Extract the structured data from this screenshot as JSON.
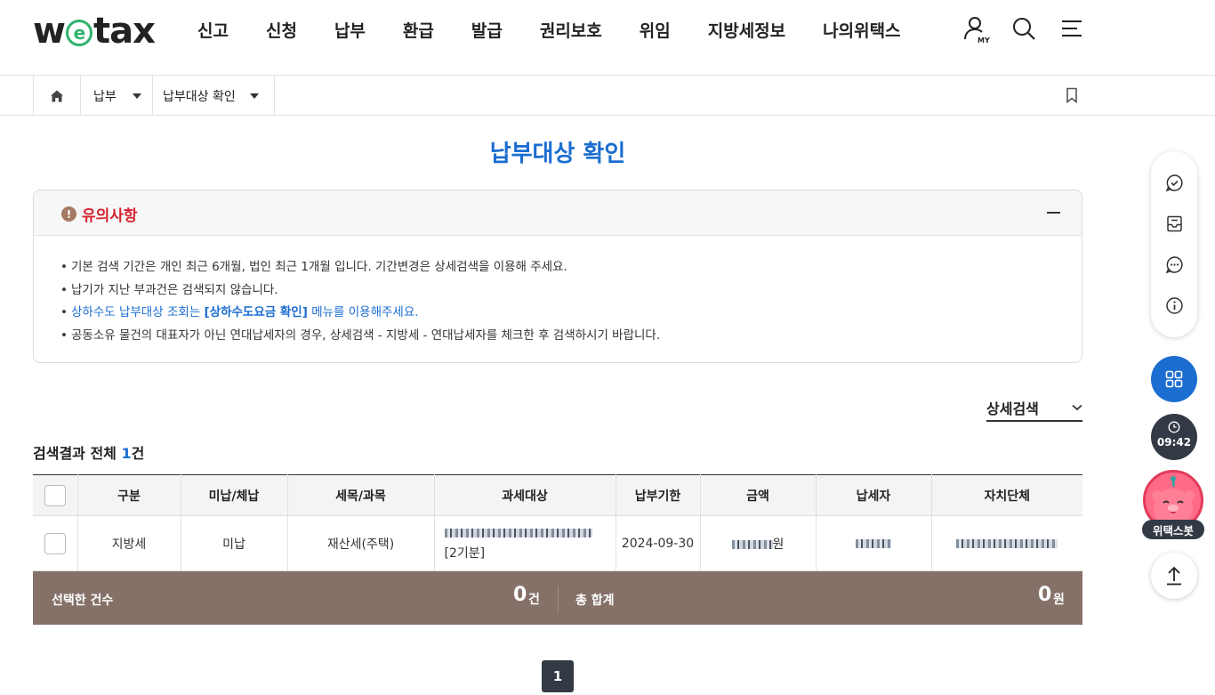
{
  "header": {
    "logo": {
      "pre": "w",
      "circle": "e",
      "post": "tax"
    },
    "menu": [
      "신고",
      "신청",
      "납부",
      "환급",
      "발급",
      "권리보호",
      "위임",
      "지방세정보",
      "나의위택스"
    ],
    "my_label": "MY"
  },
  "breadcrumb": {
    "level1": "납부",
    "level2": "납부대상 확인"
  },
  "page": {
    "title": "납부대상 확인"
  },
  "notice": {
    "title": "유의사항",
    "items": [
      "기본 검색 기간은 개인 최근 6개월, 법인 최근 1개월 입니다. 기간변경은 상세검색을 이용해 주세요.",
      "납기가 지난 부과건은 검색되지 않습니다."
    ],
    "link_item": {
      "pre": "상하수도 납부대상 조회는 ",
      "strong": "[상하수도요금 확인]",
      "post": " 메뉴를 이용해주세요."
    },
    "last_item": "공동소유 물건의 대표자가 아닌 연대납세자의 경우, 상세검색 - 지방세 - 연대납세자를 체크한 후 검색하시기 바랍니다."
  },
  "detail_search": {
    "label": "상세검색"
  },
  "result": {
    "label": "검색결과 전체 ",
    "count": "1",
    "unit": "건"
  },
  "table": {
    "headers": [
      "구분",
      "미납/체납",
      "세목/과목",
      "과세대상",
      "납부기한",
      "금액",
      "납세자",
      "자치단체"
    ],
    "rows": [
      {
        "category": "지방세",
        "status": "미납",
        "tax_item": "재산세(주택)",
        "period": "[2기분]",
        "due_date": "2024-09-30",
        "amount_unit": "원"
      }
    ]
  },
  "summary": {
    "count_label": "선택한 건수",
    "count_value": "0",
    "count_unit": "건",
    "total_label": "총 합계",
    "total_value": "0",
    "total_unit": "원"
  },
  "pagination": {
    "current": "1"
  },
  "quick_menu": {
    "timer": "09:42",
    "bot_label": "위택스봇"
  },
  "colors": {
    "accent_blue": "#1b6dd0",
    "notice_red": "#d6222e",
    "summary_bg": "#857168",
    "dark": "#333a45"
  }
}
